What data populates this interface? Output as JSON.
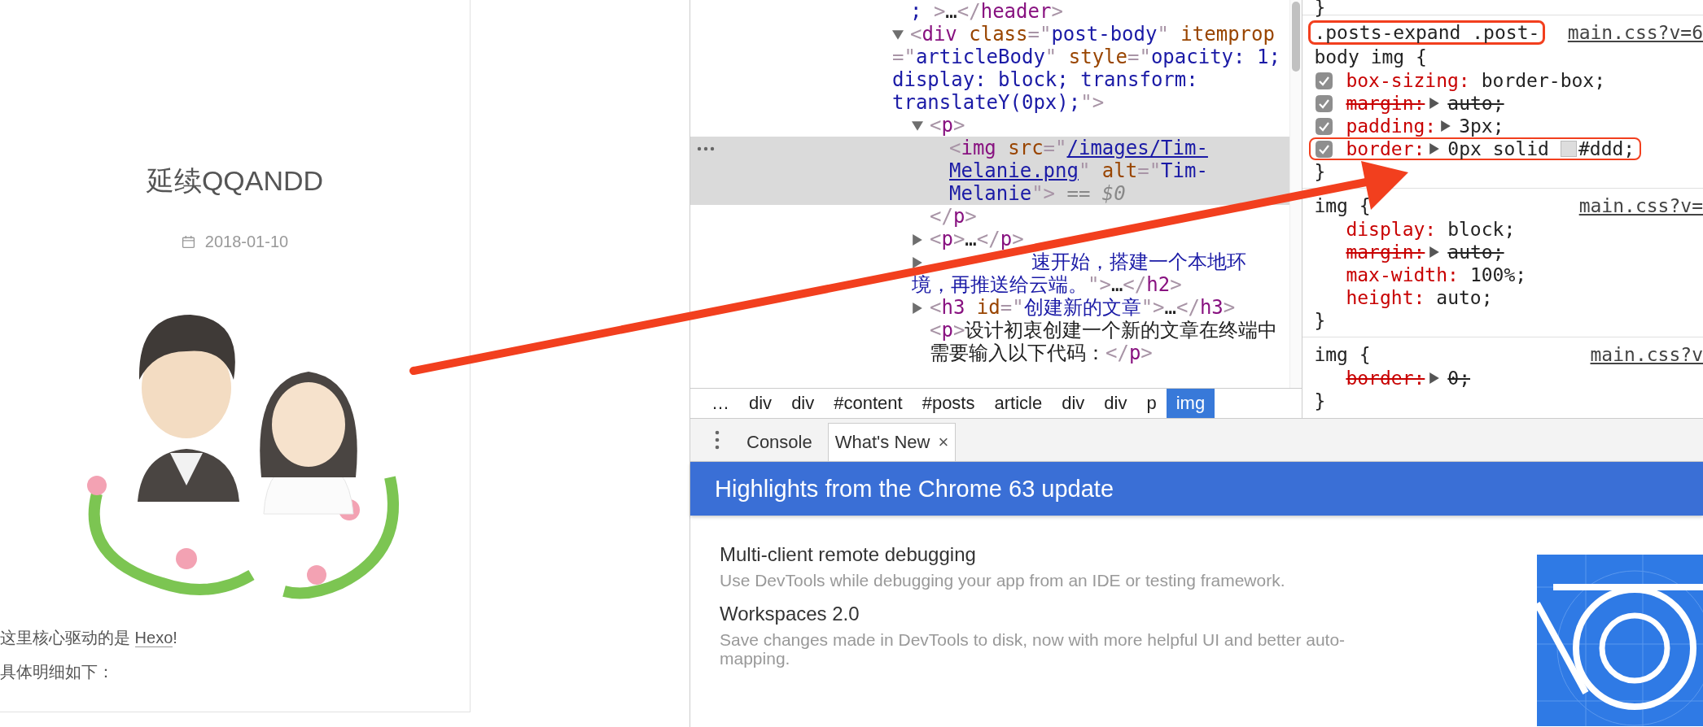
{
  "page": {
    "title": "延续QQANDD",
    "date": "2018-01-10",
    "paragraphs": [
      {
        "parts": [
          {
            "text": "这里核心驱动的是 "
          },
          {
            "link": "Hexo"
          },
          {
            "text": "!"
          }
        ]
      },
      {
        "parts": [
          {
            "text": "具体明细如下："
          }
        ]
      }
    ]
  },
  "elements": {
    "tree": [
      {
        "selected": false,
        "parts": [
          {
            "kind": "value",
            "text": ";"
          },
          {
            "kind": "punct",
            "text": " >"
          },
          {
            "kind": "text",
            "text": "…"
          },
          {
            "kind": "punct",
            "text": "</"
          },
          {
            "kind": "tag",
            "text": "header"
          },
          {
            "kind": "punct",
            "text": ">"
          }
        ]
      },
      {
        "selected": false,
        "expanded": true,
        "parts": [
          {
            "kind": "punct",
            "text": "<"
          },
          {
            "kind": "tag",
            "text": "div"
          },
          {
            "kind": "attr",
            "text": " class"
          },
          {
            "kind": "punct",
            "text": "=\""
          },
          {
            "kind": "value",
            "text": "post-body"
          },
          {
            "kind": "punct",
            "text": "\""
          },
          {
            "kind": "attr",
            "text": " itemprop"
          },
          {
            "kind": "punct",
            "text": "=\""
          },
          {
            "kind": "value",
            "text": "articleBody"
          },
          {
            "kind": "punct",
            "text": "\""
          },
          {
            "kind": "attr",
            "text": " style"
          },
          {
            "kind": "punct",
            "text": "="
          },
          {
            "kind": "punct",
            "text": "\""
          },
          {
            "kind": "value",
            "text": "opacity: 1; display: block; transform: translateY(0px);"
          },
          {
            "kind": "punct",
            "text": "\">"
          }
        ],
        "children": [
          {
            "selected": false,
            "expanded": true,
            "parts": [
              {
                "kind": "punct",
                "text": "<"
              },
              {
                "kind": "tag",
                "text": "p"
              },
              {
                "kind": "punct",
                "text": ">"
              }
            ],
            "closing": [
              {
                "kind": "punct",
                "text": "</"
              },
              {
                "kind": "tag",
                "text": "p"
              },
              {
                "kind": "punct",
                "text": ">"
              }
            ],
            "children": [
              {
                "selected": true,
                "parts": [
                  {
                    "kind": "punct",
                    "text": "<"
                  },
                  {
                    "kind": "tag",
                    "text": "img"
                  },
                  {
                    "kind": "attr",
                    "text": " src"
                  },
                  {
                    "kind": "punct",
                    "text": "=\""
                  },
                  {
                    "kind": "link",
                    "text": "/images/Tim-Melanie.png"
                  },
                  {
                    "kind": "punct",
                    "text": "\""
                  },
                  {
                    "kind": "attr",
                    "text": " alt"
                  },
                  {
                    "kind": "punct",
                    "text": "=\""
                  },
                  {
                    "kind": "value",
                    "text": "Tim-Melanie"
                  },
                  {
                    "kind": "punct",
                    "text": "\">"
                  },
                  {
                    "kind": "note",
                    "text": " == $0"
                  }
                ]
              }
            ]
          },
          {
            "selected": false,
            "expanded": false,
            "parts": [
              {
                "kind": "punct",
                "text": "<"
              },
              {
                "kind": "tag",
                "text": "p"
              },
              {
                "kind": "punct",
                "text": ">"
              },
              {
                "kind": "text",
                "text": "…"
              },
              {
                "kind": "punct",
                "text": "</"
              },
              {
                "kind": "tag",
                "text": "p"
              },
              {
                "kind": "punct",
                "text": ">"
              }
            ]
          },
          {
            "selected": false,
            "expanded": false,
            "parts": [
              {
                "kind": "value",
                "text": "速开始，搭建一个本地环境，再推送给云端。",
                "after_cover": true
              },
              {
                "kind": "punct",
                "text": "\">"
              },
              {
                "kind": "text",
                "text": "…"
              },
              {
                "kind": "punct",
                "text": "</"
              },
              {
                "kind": "tag",
                "text": "h2"
              },
              {
                "kind": "punct",
                "text": ">"
              }
            ]
          },
          {
            "selected": false,
            "expanded": false,
            "parts": [
              {
                "kind": "punct",
                "text": "<"
              },
              {
                "kind": "tag",
                "text": "h3"
              },
              {
                "kind": "attr",
                "text": " id"
              },
              {
                "kind": "punct",
                "text": "=\""
              },
              {
                "kind": "value",
                "text": "创建新的文章"
              },
              {
                "kind": "punct",
                "text": "\">"
              },
              {
                "kind": "text",
                "text": "…"
              },
              {
                "kind": "punct",
                "text": "</"
              },
              {
                "kind": "tag",
                "text": "h3"
              },
              {
                "kind": "punct",
                "text": ">"
              }
            ]
          },
          {
            "selected": false,
            "parts": [
              {
                "kind": "punct",
                "text": "<"
              },
              {
                "kind": "tag",
                "text": "p"
              },
              {
                "kind": "punct",
                "text": ">"
              },
              {
                "kind": "text",
                "text": "设计初衷创建一个新的文章在终端中需要输入以下代码："
              },
              {
                "kind": "punct",
                "text": "</"
              },
              {
                "kind": "tag",
                "text": "p"
              },
              {
                "kind": "punct",
                "text": ">"
              }
            ]
          }
        ]
      }
    ],
    "breadcrumbs": [
      {
        "label": "…",
        "selected": false
      },
      {
        "label": "div",
        "selected": false
      },
      {
        "label": "div",
        "selected": false
      },
      {
        "label": "#content",
        "selected": false
      },
      {
        "label": "#posts",
        "selected": false
      },
      {
        "label": "article",
        "selected": false
      },
      {
        "label": "div",
        "selected": false
      },
      {
        "label": "div",
        "selected": false
      },
      {
        "label": "p",
        "selected": false
      },
      {
        "label": "img",
        "selected": true
      }
    ]
  },
  "styles": {
    "prev_close": "}",
    "rules": [
      {
        "selector_lines": [
          ".posts-expand .post-",
          "body img {"
        ],
        "source": "main.css?v=6",
        "highlighted": true,
        "close": "}",
        "props": [
          {
            "checked": true,
            "name": "box-sizing:",
            "value": "border-box;",
            "overridden": false,
            "expandable": false,
            "highlighted": false
          },
          {
            "checked": true,
            "name": "margin:",
            "value": "auto;",
            "overridden": true,
            "expandable": true,
            "highlighted": false
          },
          {
            "checked": true,
            "name": "padding:",
            "value": "3px;",
            "overridden": false,
            "expandable": true,
            "highlighted": false
          },
          {
            "checked": true,
            "name": "border:",
            "value": "0px solid",
            "color": "#dddddd",
            "value_tail": "#ddd;",
            "overridden": false,
            "expandable": true,
            "highlighted": true
          }
        ]
      },
      {
        "selector_lines": [
          "img {"
        ],
        "source": "main.css?v=",
        "highlighted": false,
        "close": "}",
        "props": [
          {
            "name": "display:",
            "value": "block;",
            "overridden": false,
            "expandable": false,
            "highlighted": false
          },
          {
            "name": "margin:",
            "value": "auto;",
            "overridden": true,
            "expandable": true,
            "highlighted": false
          },
          {
            "name": "max-width:",
            "value": "100%;",
            "overridden": false,
            "expandable": false,
            "highlighted": false
          },
          {
            "name": "height:",
            "value": "auto;",
            "overridden": false,
            "expandable": false,
            "highlighted": false
          }
        ]
      },
      {
        "selector_lines": [
          "img {"
        ],
        "source": "main.css?v",
        "highlighted": false,
        "close": "}",
        "props": [
          {
            "name": "border:",
            "value": "0;",
            "overridden": true,
            "expandable": true,
            "highlighted": false
          }
        ]
      }
    ]
  },
  "drawer": {
    "tabs": [
      {
        "label": "Console",
        "selected": false,
        "closable": false
      },
      {
        "label": "What's New",
        "selected": true,
        "closable": true,
        "close": "×"
      }
    ],
    "banner": "Highlights from the Chrome 63 update",
    "features": [
      {
        "title": "Multi-client remote debugging",
        "description": "Use DevTools while debugging your app from an IDE or testing framework."
      },
      {
        "title": "Workspaces 2.0",
        "description": "Save changes made in DevTools to disk, now with more helpful UI and better auto-mapping."
      }
    ]
  }
}
